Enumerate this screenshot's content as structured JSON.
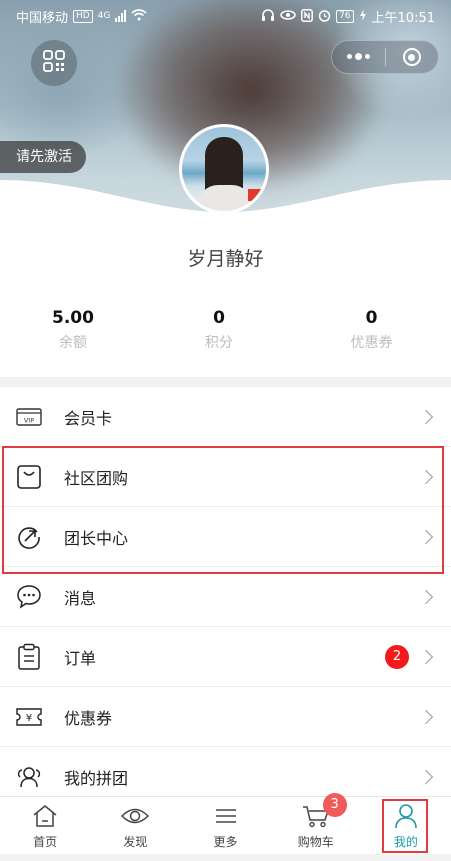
{
  "status_bar": {
    "carrier": "中国移动",
    "network_tags": [
      "HD",
      "4G"
    ],
    "battery": "76",
    "time": "上午10:51"
  },
  "header": {
    "activate_label": "请先激活",
    "username": "岁月静好"
  },
  "stats": [
    {
      "value": "5.00",
      "label": "余额"
    },
    {
      "value": "0",
      "label": "积分"
    },
    {
      "value": "0",
      "label": "优惠券"
    }
  ],
  "menu": {
    "items": [
      {
        "id": "member-card",
        "label": "会员卡",
        "icon": "vip-card-icon",
        "icon_text": "VIP"
      },
      {
        "id": "community-group-buy",
        "label": "社区团购",
        "icon": "shopping-bag-icon"
      },
      {
        "id": "leader-center",
        "label": "团长中心",
        "icon": "arrow-circle-icon"
      },
      {
        "id": "messages",
        "label": "消息",
        "icon": "chat-bubble-icon"
      },
      {
        "id": "orders",
        "label": "订单",
        "icon": "clipboard-icon",
        "badge": "2"
      },
      {
        "id": "coupons",
        "label": "优惠券",
        "icon": "coupon-icon",
        "icon_text": "¥"
      },
      {
        "id": "my-group-buy",
        "label": "我的拼团",
        "icon": "group-people-icon"
      }
    ]
  },
  "bottom_nav": {
    "items": [
      {
        "label": "首页",
        "icon": "home-icon"
      },
      {
        "label": "发现",
        "icon": "eye-icon"
      },
      {
        "label": "更多",
        "icon": "menu-lines-icon"
      },
      {
        "label": "购物车",
        "icon": "cart-icon",
        "badge": "3"
      },
      {
        "label": "我的",
        "icon": "user-icon",
        "active": true
      }
    ]
  },
  "colors": {
    "accent": "#1a9aa5",
    "highlight_border": "#e03a42",
    "badge_red": "#f21a1a",
    "cart_badge": "#f05a5a",
    "muted_label": "#bdbdbd",
    "section_gap": "#f2f2f2"
  }
}
